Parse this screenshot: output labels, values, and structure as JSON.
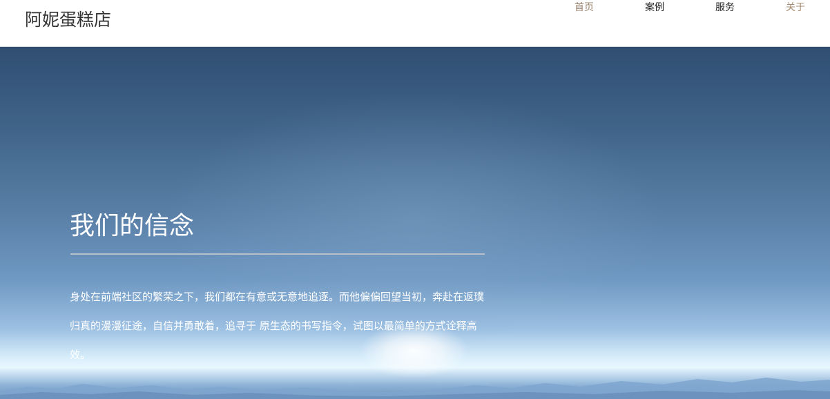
{
  "header": {
    "logo": "阿妮蛋糕店",
    "nav": [
      {
        "label": "首页"
      },
      {
        "label": "案例"
      },
      {
        "label": "服务"
      },
      {
        "label": "关于"
      }
    ]
  },
  "hero": {
    "title": "我们的信念",
    "paragraph": "身处在前端社区的繁荣之下，我们都在有意或无意地追逐。而他偏偏回望当初，奔赴在返璞归真的漫漫征途，自信并勇敢着，追寻于 原生态的书写指令，试图以最简单的方式诠释高效。"
  },
  "colors": {
    "nav_active": "#9b8570",
    "nav_default": "#222222",
    "hero_text": "#ffffff"
  }
}
